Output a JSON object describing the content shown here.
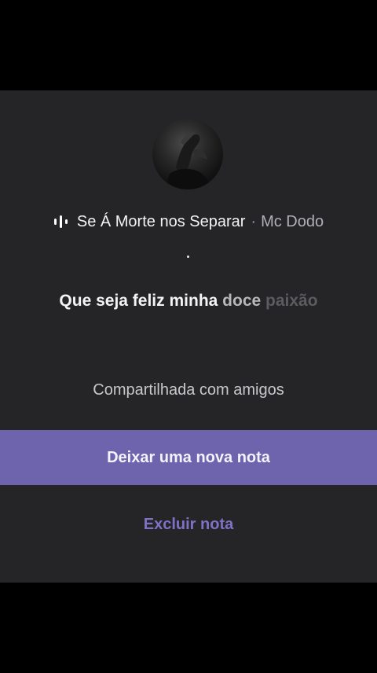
{
  "note": {
    "song_title": "Se Á Morte nos Separar",
    "separator": "·",
    "artist": "Mc Dodo",
    "lyric_sung": "Que seja feliz minha",
    "lyric_current": "doce",
    "lyric_upcoming": "paixão",
    "visibility": "Compartilhada com amigos",
    "avatar_icon": "profile-avatar",
    "music_icon": "audio-wave-icon"
  },
  "actions": {
    "primary_label": "Deixar uma nova nota",
    "delete_label": "Excluir nota"
  },
  "colors": {
    "sheet_background": "#252527",
    "primary_button": "#6e64ae",
    "delete_text": "#7f72c6"
  }
}
